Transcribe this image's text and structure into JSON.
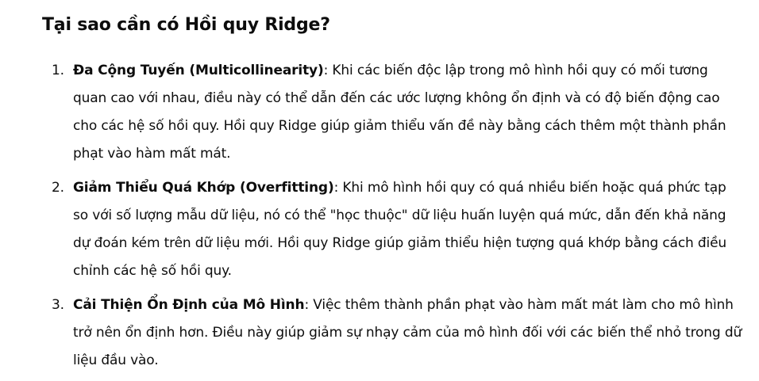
{
  "heading": "Tại sao cần có Hồi quy Ridge?",
  "items": [
    {
      "number": "1.",
      "term": "Đa Cộng Tuyến (Multicollinearity)",
      "text": ": Khi các biến độc lập trong mô hình hồi quy có mối tương quan cao với nhau, điều này có thể dẫn đến các ước lượng không ổn định và có độ biến động cao cho các hệ số hồi quy. Hồi quy Ridge giúp giảm thiểu vấn đề này bằng cách thêm một thành phần phạt vào hàm mất mát."
    },
    {
      "number": "2.",
      "term": "Giảm Thiểu Quá Khớp (Overfitting)",
      "text": ": Khi mô hình hồi quy có quá nhiều biến hoặc quá phức tạp so với số lượng mẫu dữ liệu, nó có thể \"học thuộc\" dữ liệu huấn luyện quá mức, dẫn đến khả năng dự đoán kém trên dữ liệu mới. Hồi quy Ridge giúp giảm thiểu hiện tượng quá khớp bằng cách điều chỉnh các hệ số hồi quy."
    },
    {
      "number": "3.",
      "term": "Cải Thiện Ổn Định của Mô Hình",
      "text": ": Việc thêm thành phần phạt vào hàm mất mát làm cho mô hình trở nên ổn định hơn. Điều này giúp giảm sự nhạy cảm của mô hình đối với các biến thể nhỏ trong dữ liệu đầu vào."
    }
  ]
}
